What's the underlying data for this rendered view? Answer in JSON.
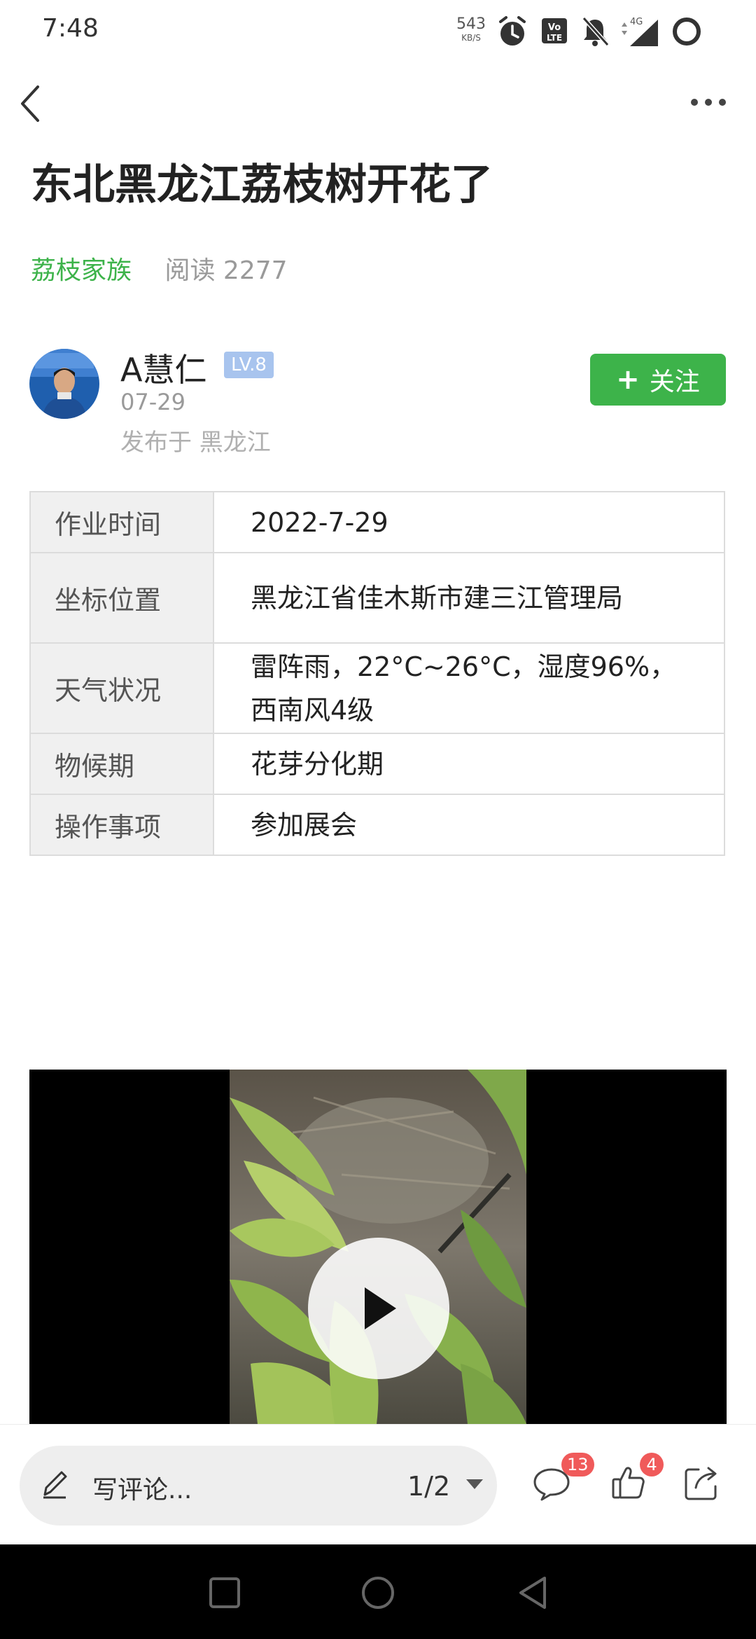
{
  "status_bar": {
    "time": "7:48",
    "speed_value": "543",
    "speed_unit": "KB/S",
    "network": "4G",
    "icons": [
      "alarm-icon",
      "volte-icon",
      "bell-muted-icon",
      "signal-icon",
      "battery-icon"
    ]
  },
  "nav": {
    "back_icon": "chevron-left-icon",
    "more_icon": "more-dots-icon"
  },
  "article": {
    "title": "东北黑龙江荔枝树开花了",
    "topic": "荔枝家族",
    "read_label": "阅读 2277"
  },
  "author": {
    "name": "A慧仁",
    "level": "LV.8",
    "date": "07-29",
    "location": "发布于 黑龙江",
    "follow_label": "关注"
  },
  "info_table": [
    {
      "key": "作业时间",
      "value": "2022-7-29"
    },
    {
      "key": "坐标位置",
      "value": "黑龙江省佳木斯市建三江管理局"
    },
    {
      "key": "天气状况",
      "value": "雷阵雨，22°C~26°C，湿度96%，西南风4级"
    },
    {
      "key": "物候期",
      "value": "花芽分化期"
    },
    {
      "key": "操作事项",
      "value": "参加展会"
    }
  ],
  "video": {
    "play_icon": "play-icon"
  },
  "bottom_bar": {
    "comment_placeholder": "写评论...",
    "page_indicator": "1/2",
    "comment_count": "13",
    "like_count": "4"
  },
  "colors": {
    "accent_green": "#3db34a",
    "badge_red": "#f05a5a",
    "level_badge": "#a8c4ee"
  }
}
